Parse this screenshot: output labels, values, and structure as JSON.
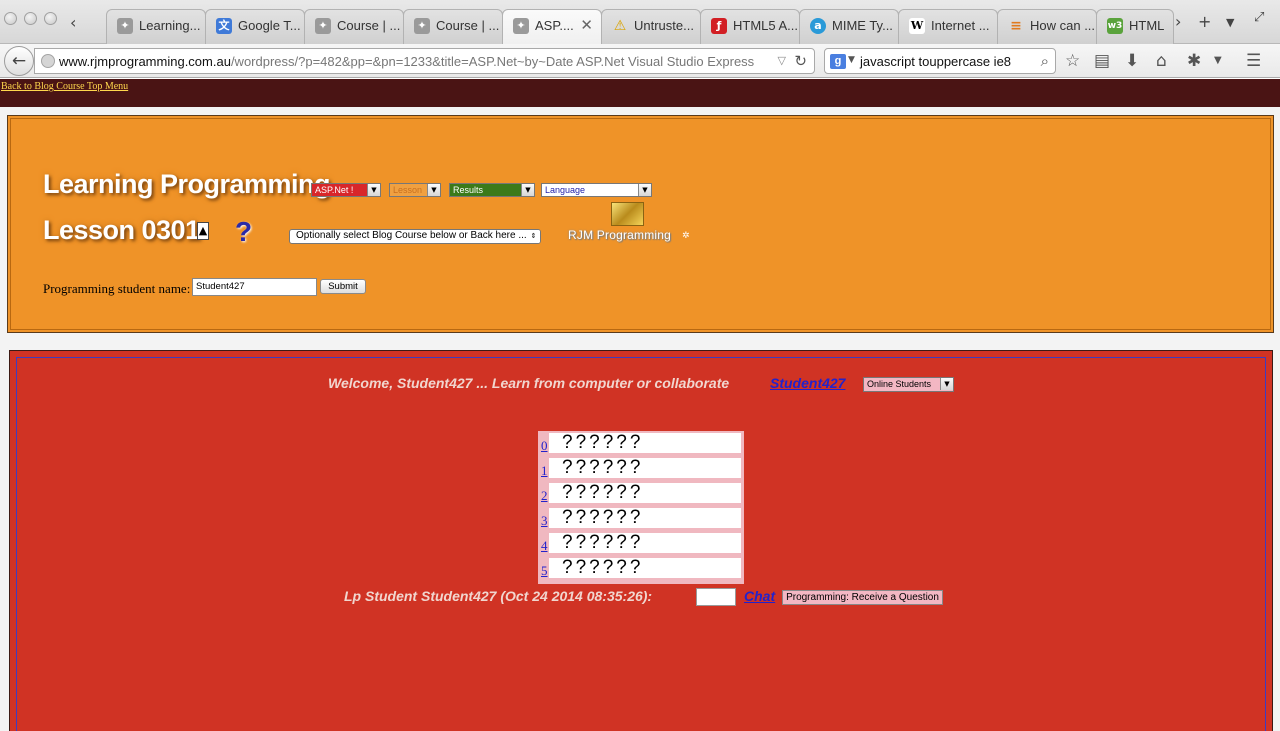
{
  "browser": {
    "tabs": [
      {
        "label": "Learning...",
        "icon": "rjm-favicon-icon"
      },
      {
        "label": "Google T...",
        "icon": "google-translate-icon"
      },
      {
        "label": "Course | ...",
        "icon": "rjm-favicon-icon"
      },
      {
        "label": "Course | ...",
        "icon": "rjm-favicon-icon"
      },
      {
        "label": "ASP....",
        "icon": "rjm-favicon-icon",
        "active": true
      },
      {
        "label": "Untruste...",
        "icon": "warning-icon"
      },
      {
        "label": "HTML5 A...",
        "icon": "flash-icon"
      },
      {
        "label": "MIME Ty...",
        "icon": "answers-icon"
      },
      {
        "label": "Internet ...",
        "icon": "wikipedia-icon"
      },
      {
        "label": "How can ...",
        "icon": "stackoverflow-icon"
      },
      {
        "label": "HTML",
        "icon": "w3schools-icon"
      }
    ],
    "url_host": "www.rjmprogramming.com.au",
    "url_rest": "/wordpress/?p=482&pp=&pn=1233&title=ASP.Net~by~Date ASP.Net Visual Studio Express",
    "search_text": "javascript touppercase ie8",
    "search_engine": "g"
  },
  "topbar": {
    "back_link": "Back to Blog Course Top Menu"
  },
  "header": {
    "site_title": "Learning Programming",
    "lesson_title": "Lesson 0301",
    "help": "?",
    "selects": {
      "asp": "ASP.Net !",
      "lesson": "Lesson",
      "results": "Results",
      "language": "Language",
      "blog": "Optionally select Blog Course below or Back here ..."
    },
    "logo_text": "RJM Programming",
    "student_label": "Programming student name:",
    "student_value": "Student427",
    "submit_label": "Submit"
  },
  "main": {
    "welcome": "Welcome, Student427 ... Learn from computer or collaborate",
    "student_link": "Student427",
    "online_select": "Online Students",
    "questions": [
      {
        "num": "0",
        "text": "??????"
      },
      {
        "num": "1",
        "text": "??????"
      },
      {
        "num": "2",
        "text": "??????"
      },
      {
        "num": "3",
        "text": "??????"
      },
      {
        "num": "4",
        "text": "??????"
      },
      {
        "num": "5",
        "text": "??????"
      }
    ],
    "lp_student": "Lp Student Student427 (Oct 24 2014 08:35:26):",
    "chat_link": "Chat",
    "receive_button": "Programming: Receive a Question"
  },
  "colors": {
    "header_orange": "#ef9328",
    "main_red": "#d03324",
    "topstrip": "#4a1414",
    "link_blue": "#2222cc"
  }
}
